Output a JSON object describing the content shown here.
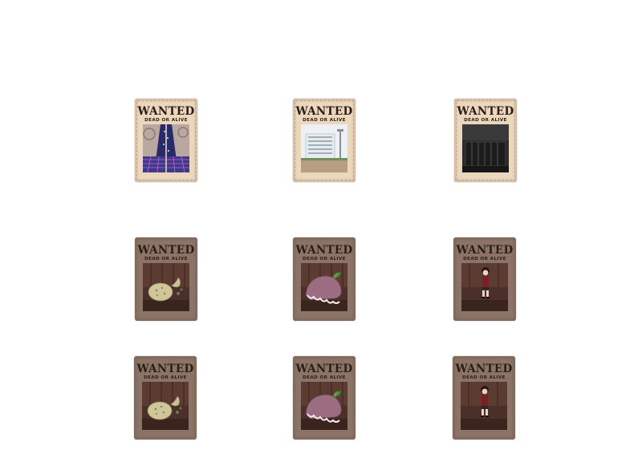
{
  "posters": [
    {
      "title": "WANTED",
      "subtitle": "DEAD OR ALIVE",
      "picture": "neon-tower-icon",
      "paper": "light"
    },
    {
      "title": "WANTED",
      "subtitle": "DEAD OR ALIVE",
      "picture": "building-icon",
      "paper": "light"
    },
    {
      "title": "WANTED",
      "subtitle": "DEAD OR ALIVE",
      "picture": "dark-room-icon",
      "paper": "light"
    },
    {
      "title": "WANTED",
      "subtitle": "DEAD OR ALIVE",
      "picture": "potato-creature-icon",
      "paper": "dark"
    },
    {
      "title": "WANTED",
      "subtitle": "DEAD OR ALIVE",
      "picture": "eggplant-creature-icon",
      "paper": "dark"
    },
    {
      "title": "WANTED",
      "subtitle": "DEAD OR ALIVE",
      "picture": "girl-character-icon",
      "paper": "dark"
    },
    {
      "title": "WANTED",
      "subtitle": "DEAD OR ALIVE",
      "picture": "potato-creature-icon",
      "paper": "dark"
    },
    {
      "title": "WANTED",
      "subtitle": "DEAD OR ALIVE",
      "picture": "eggplant-creature-icon",
      "paper": "dark"
    },
    {
      "title": "WANTED",
      "subtitle": "DEAD OR ALIVE",
      "picture": "girl-character-icon",
      "paper": "dark"
    }
  ],
  "colors": {
    "paper_light": "#ecd7bd",
    "paper_dark": "#8b7467",
    "ink": "#2a1d16"
  }
}
